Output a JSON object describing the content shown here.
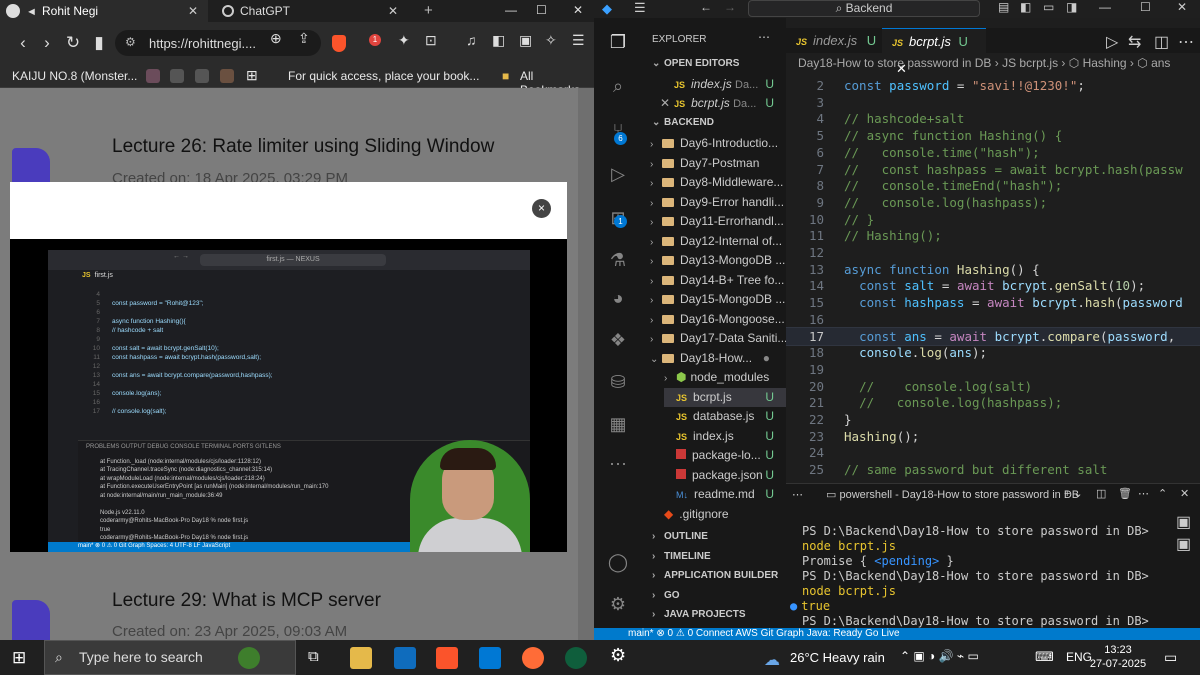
{
  "browser": {
    "tabs": [
      {
        "label": "Rohit Negi",
        "favicon": "globe-icon",
        "active": true
      },
      {
        "label": "ChatGPT",
        "favicon": "openai-icon",
        "active": false
      }
    ],
    "url": "https://rohittnegi....",
    "brave_badge": "1",
    "bookmarks": {
      "first": "KAIJU NO.8 (Monster...",
      "hint": "For quick access, place your book...",
      "all": "All Bookmarks"
    },
    "lectures": [
      {
        "title": "Lecture 26: Rate limiter using Sliding Window",
        "date": "Created on: 18 Apr 2025, 03:29 PM"
      },
      {
        "title": "Lecture 29: What is MCP server",
        "date": "Created on: 23 Apr 2025, 09:03 AM"
      }
    ],
    "modal_close": "×",
    "video": {
      "window_title": "first.js — NEXUS",
      "tab": "first.js",
      "code": [
        {
          "n": "4",
          "t": ""
        },
        {
          "n": "5",
          "t": "const password = \"Rohit@123\";"
        },
        {
          "n": "6",
          "t": ""
        },
        {
          "n": "7",
          "t": "async function Hashing(){"
        },
        {
          "n": "8",
          "t": "// hashcode + salt"
        },
        {
          "n": "9",
          "t": ""
        },
        {
          "n": "10",
          "t": "const salt = await bcrypt.genSalt(10);"
        },
        {
          "n": "11",
          "t": "const hashpass = await bcrypt.hash(password,salt);"
        },
        {
          "n": "12",
          "t": ""
        },
        {
          "n": "13",
          "t": "const ans = await bcrypt.compare(password,hashpass);"
        },
        {
          "n": "14",
          "t": ""
        },
        {
          "n": "15",
          "t": "console.log(ans);"
        },
        {
          "n": "16",
          "t": ""
        },
        {
          "n": "17",
          "t": "// console.log(salt);"
        }
      ],
      "panel_tabs": [
        "PROBLEMS",
        "OUTPUT",
        "DEBUG CONSOLE",
        "TERMINAL",
        "PORTS",
        "GITLENS"
      ],
      "terminal_lines": [
        "at Function._load (node:internal/modules/cjs/loader:1128:12)",
        "at TracingChannel.traceSync (node:diagnostics_channel:315:14)",
        "at wrapModuleLoad (node:internal/modules/cjs/loader:218:24)",
        "at Function.executeUserEntryPoint [as runMain] (node:internal/modules/run_main:170",
        "at node:internal/main/run_main_module:36:49",
        "",
        "Node.js v22.11.0",
        "coderarmy@Rohits-MacBook-Pro Day18 % node first.js",
        "true",
        "coderarmy@Rohits-MacBook-Pro Day18 % node first.js"
      ],
      "status": "main*  ⊗ 0 ⚠ 0  Git Graph      Spaces: 4  UTF-8  LF  JavaScript"
    }
  },
  "vscode": {
    "search": "Backend",
    "explorer_title": "EXPLORER",
    "open_editors_label": "OPEN EDITORS",
    "open_editors": [
      {
        "name": "index.js",
        "dir": "Da...",
        "status": "U"
      },
      {
        "name": "bcrpt.js",
        "dir": "Da...",
        "status": "U"
      }
    ],
    "root_label": "BACKEND",
    "folders": [
      "Day6-Introductio...",
      "Day7-Postman",
      "Day8-Middleware...",
      "Day9-Error handli...",
      "Day11-Errorhandl...",
      "Day12-Internal of...",
      "Day13-MongoDB ...",
      "Day14-B+ Tree fo...",
      "Day15-MongoDB ...",
      "Day16-Mongoose...",
      "Day17-Data Saniti...",
      "Day18-How..."
    ],
    "day18_children": [
      {
        "name": "node_modules",
        "kind": "node-folder",
        "status": ""
      },
      {
        "name": "bcrpt.js",
        "kind": "js",
        "status": "U"
      },
      {
        "name": "database.js",
        "kind": "js",
        "status": "U"
      },
      {
        "name": "index.js",
        "kind": "js",
        "status": "U"
      },
      {
        "name": "package-lo...",
        "kind": "npm",
        "status": "U"
      },
      {
        "name": "package.json",
        "kind": "npm",
        "status": "U"
      },
      {
        "name": "readme.md",
        "kind": "md",
        "status": "U"
      }
    ],
    "gitignore": ".gitignore",
    "bottom_sections": [
      "OUTLINE",
      "TIMELINE",
      "APPLICATION BUILDER",
      "GO",
      "JAVA PROJECTS"
    ],
    "scm_badge": "6",
    "ext_badge": "1",
    "tabs": [
      {
        "name": "index.js",
        "status": "U"
      },
      {
        "name": "bcrpt.js",
        "status": "U"
      }
    ],
    "breadcrumb": "Day18-How to store password in DB  ›  JS bcrpt.js  ›  ⬡ Hashing  ›  ⬡ ans",
    "code": [
      {
        "n": "2",
        "html": "<span class='kw'>const</span> <span class='vr'>password</span> <span class='pl'>=</span> <span class='st'>\"savi!!@1230!\"</span><span class='pl'>;</span>"
      },
      {
        "n": "3",
        "html": ""
      },
      {
        "n": "4",
        "html": "<span class='cm'>// hashcode+salt</span>"
      },
      {
        "n": "5",
        "html": "<span class='cm'>// async function Hashing() {</span>"
      },
      {
        "n": "6",
        "html": "<span class='cm'>//   console.time(\"hash\");</span>"
      },
      {
        "n": "7",
        "html": "<span class='cm'>//   const hashpass = await bcrypt.hash(passw</span>"
      },
      {
        "n": "8",
        "html": "<span class='cm'>//   console.timeEnd(\"hash\");</span>"
      },
      {
        "n": "9",
        "html": "<span class='cm'>//   console.log(hashpass);</span>"
      },
      {
        "n": "10",
        "html": "<span class='cm'>// }</span>"
      },
      {
        "n": "11",
        "html": "<span class='cm'>// Hashing();</span>"
      },
      {
        "n": "12",
        "html": ""
      },
      {
        "n": "13",
        "html": "<span class='kw'>async</span> <span class='kw'>function</span> <span class='fn'>Hashing</span><span class='pl'>() {</span>"
      },
      {
        "n": "14",
        "html": "  <span class='kw'>const</span> <span class='vr'>salt</span> <span class='pl'>=</span> <span class='k2'>await</span> <span class='pv'>bcrypt</span><span class='pl'>.</span><span class='fn'>genSalt</span><span class='pl'>(</span><span class='nm'>10</span><span class='pl'>);</span>"
      },
      {
        "n": "15",
        "html": "  <span class='kw'>const</span> <span class='vr'>hashpass</span> <span class='pl'>=</span> <span class='k2'>await</span> <span class='pv'>bcrypt</span><span class='pl'>.</span><span class='fn'>hash</span><span class='pl'>(</span><span class='pv'>password</span>"
      },
      {
        "n": "16",
        "html": ""
      },
      {
        "n": "17",
        "html": "  <span class='kw'>const</span> <span class='vr'>ans</span> <span class='pl'>=</span> <span class='k2'>await</span> <span class='pv'>bcrypt</span><span class='pl'>.</span><span class='fn'>compare</span><span class='pl'>(</span><span class='pv'>password</span><span class='pl'>,</span>"
      },
      {
        "n": "18",
        "html": "  <span class='pv'>console</span><span class='pl'>.</span><span class='fn'>log</span><span class='pl'>(</span><span class='pv'>ans</span><span class='pl'>);</span>"
      },
      {
        "n": "19",
        "html": ""
      },
      {
        "n": "20",
        "html": "  <span class='cm'>//    console.log(salt)</span>"
      },
      {
        "n": "21",
        "html": "  <span class='cm'>//   console.log(hashpass);</span>"
      },
      {
        "n": "22",
        "html": "<span class='pl'>}</span>"
      },
      {
        "n": "23",
        "html": "<span class='fn'>Hashing</span><span class='pl'>();</span>"
      },
      {
        "n": "24",
        "html": ""
      },
      {
        "n": "25",
        "html": "<span class='cm'>// same password but different salt</span>"
      }
    ],
    "active_line": "17",
    "terminal_title": "powershell - Day18-How to store password in DB",
    "terminal_lines": [
      "PS D:\\Backend\\Day18-How to store password in DB> node bcrpt.js",
      "Promise { <pending> }",
      "PS D:\\Backend\\Day18-How to store password in DB> node bcrpt.js",
      "true",
      "PS D:\\Backend\\Day18-How to store password in DB> "
    ],
    "status": "main*   ⊗ 0 ⚠ 0   Connect   AWS   Git Graph   Java: Ready   Go Live"
  },
  "taskbar": {
    "search_placeholder": "Type here to search",
    "weather": "26°C  Heavy rain",
    "lang": "ENG",
    "time": "13:23",
    "date": "27-07-2025"
  },
  "colors": {
    "vscode_accent": "#007acc",
    "untracked": "#73c991",
    "brave": "#fb542b",
    "lecture_icon": "#4a3cbd"
  }
}
